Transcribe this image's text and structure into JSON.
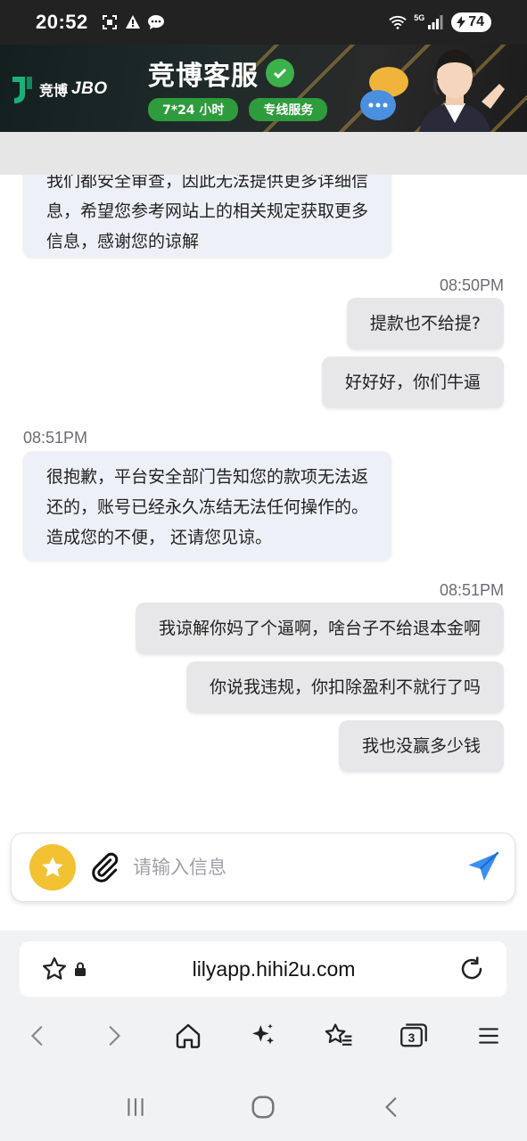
{
  "status_bar": {
    "time": "20:52",
    "network": "5G",
    "battery": "74"
  },
  "banner": {
    "logo_cn": "竞博",
    "logo_en": "JBO",
    "title": "竞博客服",
    "pill_hours": "7*24 小时",
    "pill_service": "专线服务"
  },
  "chat": {
    "messages": [
      {
        "side": "left",
        "text_lines": [
          "我们都安全审查，因此无法提供更多详细信",
          "息，希望您参考网站上的相关规定获取更多",
          "信息，感谢您的谅解"
        ]
      },
      {
        "side": "right",
        "time": "08:50PM",
        "text": "提款也不给提?"
      },
      {
        "side": "right",
        "text": "好好好，你们牛逼"
      },
      {
        "side": "left",
        "time": "08:51PM",
        "text_lines": [
          "很抱歉，平台安全部门告知您的款项无法返",
          "还的，账号已经永久冻结无法任何操作的。",
          "造成您的不便， 还请您见谅。"
        ]
      },
      {
        "side": "right",
        "time": "08:51PM",
        "text": "我谅解你妈了个逼啊，啥台子不给退本金啊"
      },
      {
        "side": "right",
        "text": "你说我违规，你扣除盈利不就行了吗"
      },
      {
        "side": "right",
        "text": "我也没赢多少钱"
      }
    ],
    "input_placeholder": "请输入信息"
  },
  "browser": {
    "url": "lilyapp.hihi2u.com",
    "tab_count": "3"
  },
  "colors": {
    "incoming_bubble": "#eef0f7",
    "outgoing_bubble": "#e7e7e9",
    "send_accent": "#3b8ff0",
    "emoji_button": "#f2c232",
    "banner_green": "#2e9b3c"
  }
}
